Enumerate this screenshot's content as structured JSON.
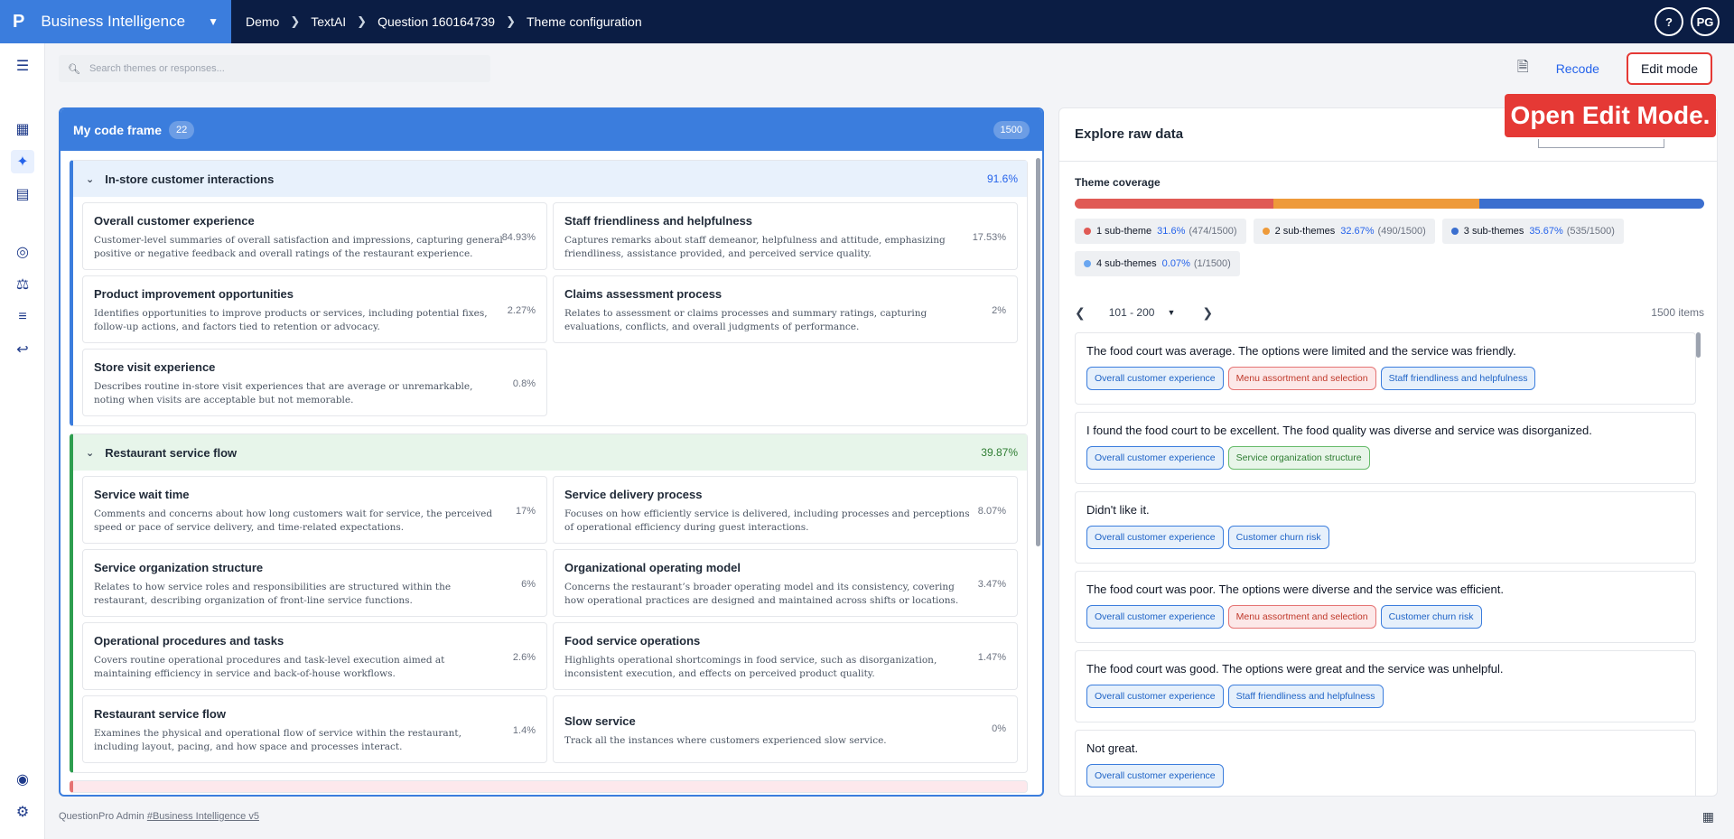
{
  "topbar": {
    "logo": "P",
    "app_name": "Business Intelligence",
    "breadcrumbs": [
      "Demo",
      "TextAI",
      "Question 160164739",
      "Theme configuration"
    ],
    "help_label": "?",
    "avatar_initials": "PG"
  },
  "header": {
    "search_placeholder": "Search themes or responses...",
    "recode_label": "Recode",
    "edit_mode_label": "Edit mode",
    "callout_text": "Open Edit Mode."
  },
  "codeframe": {
    "title": "My code frame",
    "count": "22",
    "total": "1500",
    "groups": [
      {
        "name": "In-store customer interactions",
        "pct": "91.6%",
        "color": "blue",
        "themes": [
          {
            "title": "Overall customer experience",
            "desc": "Customer-level summaries of overall satisfaction and impressions, capturing general positive or negative feedback and overall ratings of the restaurant experience.",
            "pct": "84.93%"
          },
          {
            "title": "Staff friendliness and helpfulness",
            "desc": "Captures remarks about staff demeanor, helpfulness and attitude, emphasizing friendliness, assistance provided, and perceived service quality.",
            "pct": "17.53%"
          },
          {
            "title": "Product improvement opportunities",
            "desc": "Identifies opportunities to improve products or services, including potential fixes, follow-up actions, and factors tied to retention or advocacy.",
            "pct": "2.27%"
          },
          {
            "title": "Claims assessment process",
            "desc": "Relates to assessment or claims processes and summary ratings, capturing evaluations, conflicts, and overall judgments of performance.",
            "pct": "2%"
          },
          {
            "title": "Store visit experience",
            "desc": "Describes routine in-store visit experiences that are average or unremarkable, noting when visits are acceptable but not memorable.",
            "pct": "0.8%"
          }
        ]
      },
      {
        "name": "Restaurant service flow",
        "pct": "39.87%",
        "color": "green",
        "themes": [
          {
            "title": "Service wait time",
            "desc": "Comments and concerns about how long customers wait for service, the perceived speed or pace of service delivery, and time-related expectations.",
            "pct": "17%"
          },
          {
            "title": "Service delivery process",
            "desc": "Focuses on how efficiently service is delivered, including processes and perceptions of operational efficiency during guest interactions.",
            "pct": "8.07%"
          },
          {
            "title": "Service organization structure",
            "desc": "Relates to how service roles and responsibilities are structured within the restaurant, describing organization of front-line service functions.",
            "pct": "6%"
          },
          {
            "title": "Organizational operating model",
            "desc": "Concerns the restaurant’s broader operating model and its consistency, covering how operational practices are designed and maintained across shifts or locations.",
            "pct": "3.47%"
          },
          {
            "title": "Operational procedures and tasks",
            "desc": "Covers routine operational procedures and task-level execution aimed at maintaining efficiency in service and back-of-house workflows.",
            "pct": "2.6%"
          },
          {
            "title": "Food service operations",
            "desc": "Highlights operational shortcomings in food service, such as disorganization, inconsistent execution, and effects on perceived product quality.",
            "pct": "1.47%"
          },
          {
            "title": "Restaurant service flow",
            "desc": "Examines the physical and operational flow of service within the restaurant, including layout, pacing, and how space and processes interact.",
            "pct": "1.4%"
          },
          {
            "title": "Slow service",
            "desc": "Track all the instances where customers experienced slow service.",
            "pct": "0%"
          }
        ]
      }
    ]
  },
  "explore": {
    "title": "Explore raw data",
    "coverage_label": "Theme coverage",
    "coverage": [
      {
        "label": "1 sub-theme",
        "pct": "31.6%",
        "count": "(474/1500)",
        "color": "#e05a55",
        "share": 31.6
      },
      {
        "label": "2 sub-themes",
        "pct": "32.67%",
        "count": "(490/1500)",
        "color": "#ee9a3a",
        "share": 32.67
      },
      {
        "label": "3 sub-themes",
        "pct": "35.67%",
        "count": "(535/1500)",
        "color": "#3b6fcf",
        "share": 35.67
      },
      {
        "label": "4 sub-themes",
        "pct": "0.07%",
        "count": "(1/1500)",
        "color": "#6aa6f0",
        "share": 0.07
      }
    ],
    "pager": {
      "range": "101 - 200",
      "items": "1500 items"
    },
    "responses": [
      {
        "text": "The food court was average. The options were limited and the service was friendly.",
        "tags": [
          [
            "Overall customer experience",
            "blue"
          ],
          [
            "Menu assortment and selection",
            "red"
          ],
          [
            "Staff friendliness and helpfulness",
            "blue"
          ]
        ]
      },
      {
        "text": "I found the food court to be excellent. The food quality was diverse and service was disorganized.",
        "tags": [
          [
            "Overall customer experience",
            "blue"
          ],
          [
            "Service organization structure",
            "green"
          ]
        ]
      },
      {
        "text": "Didn't like it.",
        "tags": [
          [
            "Overall customer experience",
            "blue"
          ],
          [
            "Customer churn risk",
            "blue"
          ]
        ]
      },
      {
        "text": "The food court was poor. The options were diverse and the service was efficient.",
        "tags": [
          [
            "Overall customer experience",
            "blue"
          ],
          [
            "Menu assortment and selection",
            "red"
          ],
          [
            "Customer churn risk",
            "blue"
          ]
        ]
      },
      {
        "text": "The food court was good. The options were great and the service was unhelpful.",
        "tags": [
          [
            "Overall customer experience",
            "blue"
          ],
          [
            "Staff friendliness and helpfulness",
            "blue"
          ]
        ]
      },
      {
        "text": "Not great.",
        "tags": [
          [
            "Overall customer experience",
            "blue"
          ]
        ]
      }
    ]
  },
  "footer": {
    "prefix": "QuestionPro Admin",
    "link": "#Business Intelligence v5"
  }
}
